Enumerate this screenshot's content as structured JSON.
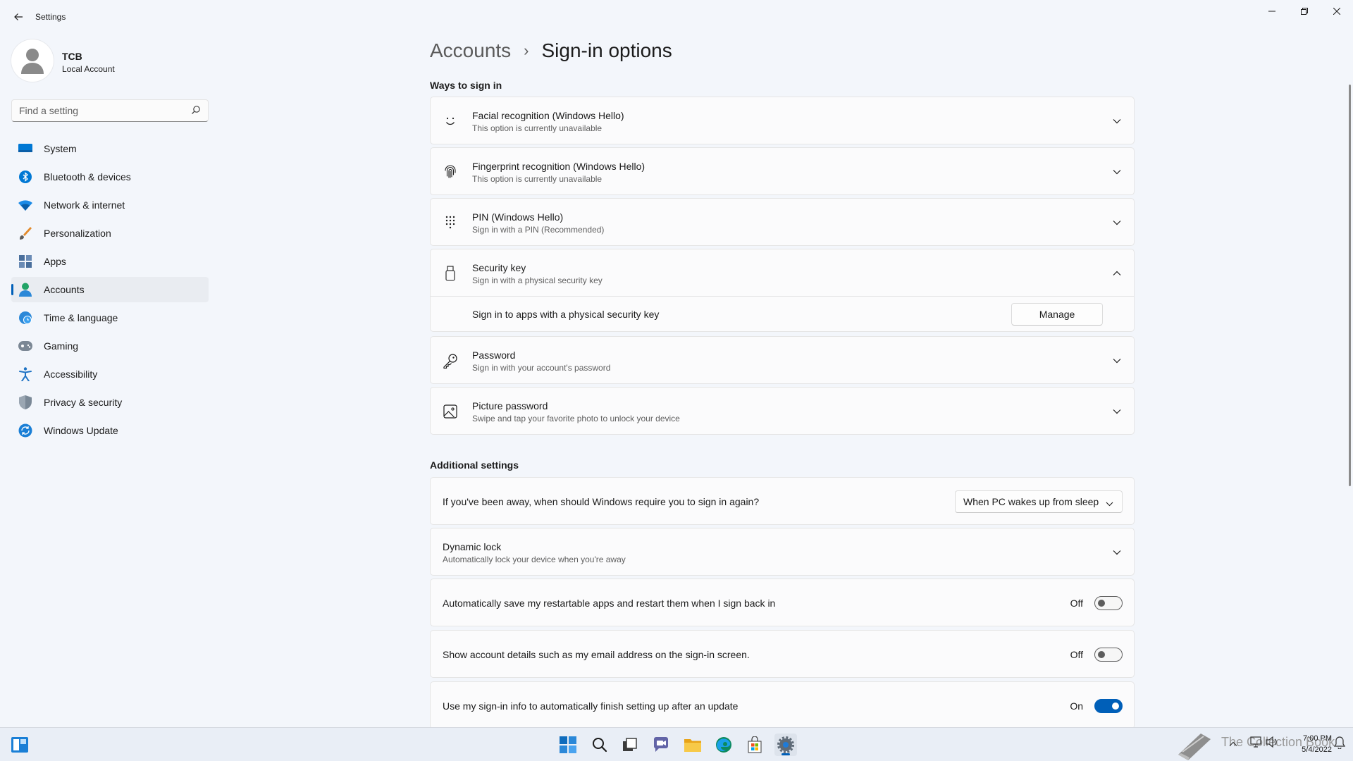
{
  "window": {
    "title": "Settings",
    "minimize_glyph": "—",
    "close_glyph": "✕"
  },
  "profile": {
    "name": "TCB",
    "account_type": "Local Account"
  },
  "search": {
    "placeholder": "Find a setting"
  },
  "sidebar": {
    "items": [
      {
        "label": "System",
        "icon": "monitor-icon"
      },
      {
        "label": "Bluetooth & devices",
        "icon": "bluetooth-icon"
      },
      {
        "label": "Network & internet",
        "icon": "wifi-icon"
      },
      {
        "label": "Personalization",
        "icon": "brush-icon"
      },
      {
        "label": "Apps",
        "icon": "apps-icon"
      },
      {
        "label": "Accounts",
        "icon": "person-icon",
        "active": true
      },
      {
        "label": "Time & language",
        "icon": "globe-clock-icon"
      },
      {
        "label": "Gaming",
        "icon": "gamepad-icon"
      },
      {
        "label": "Accessibility",
        "icon": "accessibility-icon"
      },
      {
        "label": "Privacy & security",
        "icon": "shield-icon"
      },
      {
        "label": "Windows Update",
        "icon": "update-icon"
      }
    ]
  },
  "breadcrumb": {
    "parent": "Accounts",
    "separator": "›",
    "current": "Sign-in options"
  },
  "ways_to_sign_in": {
    "title": "Ways to sign in",
    "facial": {
      "title": "Facial recognition (Windows Hello)",
      "subtitle": "This option is currently unavailable",
      "icon": "face-icon"
    },
    "fingerprint": {
      "title": "Fingerprint recognition (Windows Hello)",
      "subtitle": "This option is currently unavailable",
      "icon": "fingerprint-icon"
    },
    "pin": {
      "title": "PIN (Windows Hello)",
      "subtitle": "Sign in with a PIN (Recommended)",
      "icon": "keypad-icon"
    },
    "security_key": {
      "title": "Security key",
      "subtitle": "Sign in with a physical security key",
      "icon": "usb-key-icon",
      "expanded": true,
      "detail_text": "Sign in to apps with a physical security key",
      "button_label": "Manage"
    },
    "password": {
      "title": "Password",
      "subtitle": "Sign in with your account's password",
      "icon": "key-icon"
    },
    "picture_password": {
      "title": "Picture password",
      "subtitle": "Swipe and tap your favorite photo to unlock your device",
      "icon": "image-icon"
    }
  },
  "additional_settings": {
    "title": "Additional settings",
    "require_sign_in": {
      "label": "If you've been away, when should Windows require you to sign in again?",
      "selected": "When PC wakes up from sleep"
    },
    "dynamic_lock": {
      "title": "Dynamic lock",
      "subtitle": "Automatically lock your device when you're away"
    },
    "restart_apps": {
      "label": "Automatically save my restartable apps and restart them when I sign back in",
      "state_label": "Off",
      "on": false
    },
    "account_details": {
      "label": "Show account details such as my email address on the sign-in screen.",
      "state_label": "Off",
      "on": false
    },
    "use_sign_in_info": {
      "label": "Use my sign-in info to automatically finish setting up after an update",
      "state_label": "On",
      "on": true
    }
  },
  "taskbar": {
    "apps": [
      "start-icon",
      "search-icon",
      "task-view-icon",
      "chat-icon",
      "file-explorer-icon",
      "edge-icon",
      "store-icon",
      "settings-icon"
    ],
    "watermark": "The Collection Book",
    "clock": {
      "time": "7:00 PM",
      "date": "5/4/2022"
    }
  },
  "colors": {
    "accent": "#005fb8",
    "background": "#f3f6fb",
    "card": "#fbfbfc"
  }
}
